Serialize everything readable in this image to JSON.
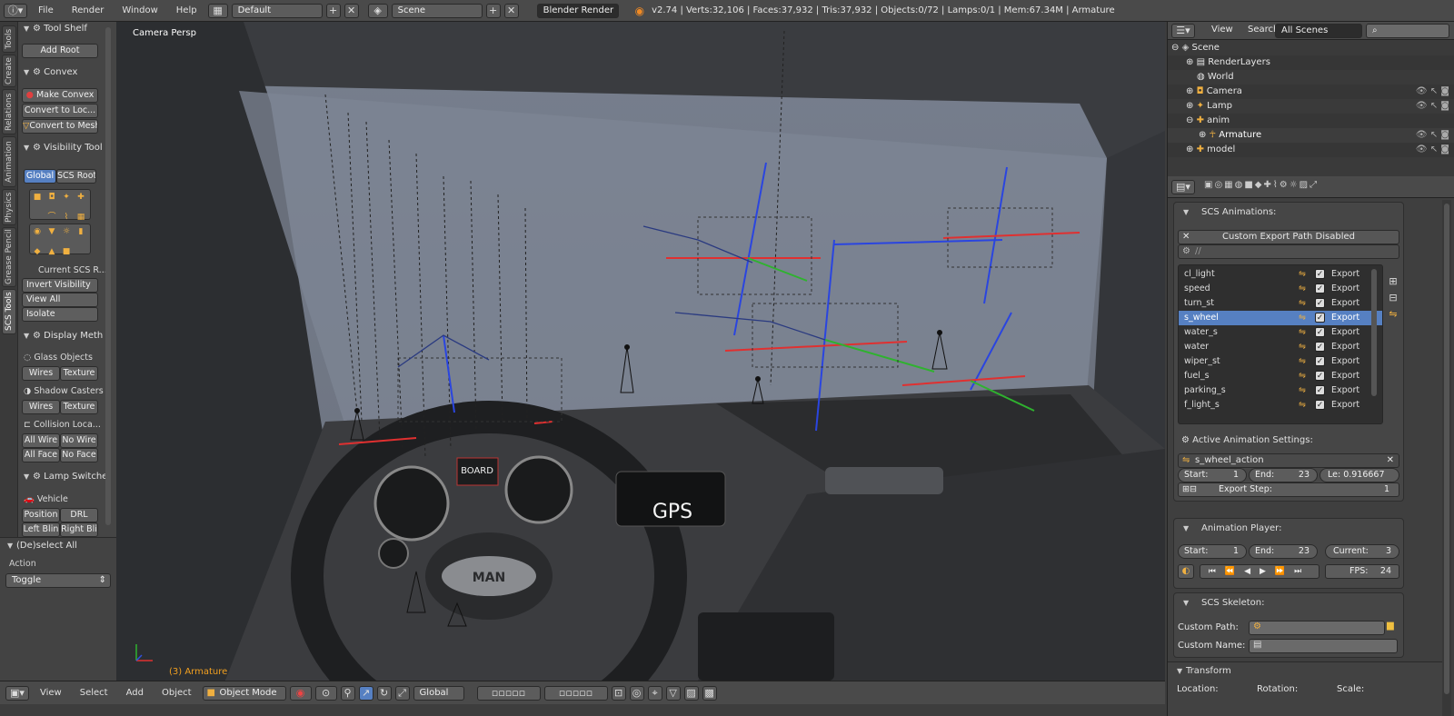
{
  "topbar": {
    "menus": [
      "File",
      "Render",
      "Window",
      "Help"
    ],
    "screen_layout": "Default",
    "scene": "Scene",
    "render_engine": "Blender Render",
    "stats": "v2.74 | Verts:32,106 | Faces:37,932 | Tris:37,932 | Objects:0/72 | Lamps:0/1 | Mem:67.34M | Armature"
  },
  "left_tabs": [
    "Tools",
    "Create",
    "Relations",
    "Animation",
    "Physics",
    "Grease Pencil",
    "SCS Tools"
  ],
  "shelf": {
    "tool_shelf": {
      "title": "Tool Shelf",
      "add_root": "Add Root"
    },
    "convex": {
      "title": "Convex",
      "make_convex": "Make Convex",
      "convert_loc": "Convert to Loc...",
      "convert_mesh": "Convert to Mesh"
    },
    "visibility": {
      "title": "Visibility Tool",
      "global": "Global",
      "scs_root": "SCS Root",
      "current": "Current SCS R...",
      "invert": "Invert Visibility",
      "view_all": "View All",
      "isolate": "Isolate"
    },
    "display": {
      "title": "Display Meth",
      "glass": "Glass Objects",
      "shadow": "Shadow Casters",
      "collision": "Collision Loca...",
      "wires": "Wires",
      "texture": "Texture",
      "all_wire": "All Wire",
      "no_wire": "No Wire",
      "all_face": "All Face",
      "no_face": "No Face"
    },
    "lamp": {
      "title": "Lamp Switche",
      "vehicle": "Vehicle",
      "position": "Position",
      "drl": "DRL",
      "left_blink": "Left Blin",
      "right_blink": "Right Bli"
    },
    "operator": {
      "title": "(De)select All",
      "action_label": "Action",
      "action_value": "Toggle"
    }
  },
  "viewport": {
    "view_label": "Camera Persp",
    "object_label": "(3) Armature",
    "board_text": "BOARD",
    "gps_text": "GPS",
    "brand_text": "MAN"
  },
  "bottombar": {
    "menus": [
      "View",
      "Select",
      "Add",
      "Object"
    ],
    "mode": "Object Mode",
    "orientation": "Global"
  },
  "outliner": {
    "view": "View",
    "search": "Search",
    "filter": "All Scenes",
    "items": [
      {
        "name": "Scene",
        "indent": 0
      },
      {
        "name": "RenderLayers",
        "indent": 1
      },
      {
        "name": "World",
        "indent": 1
      },
      {
        "name": "Camera",
        "indent": 1
      },
      {
        "name": "Lamp",
        "indent": 1
      },
      {
        "name": "anim",
        "indent": 1
      },
      {
        "name": "Armature",
        "indent": 2
      },
      {
        "name": "model",
        "indent": 1
      }
    ]
  },
  "props": {
    "scs_animations": "SCS Animations:",
    "custom_export": "Custom Export Path Disabled",
    "path_placeholder": "//",
    "animations": [
      {
        "name": "cl_light",
        "export": "Export"
      },
      {
        "name": "speed",
        "export": "Export"
      },
      {
        "name": "turn_st",
        "export": "Export"
      },
      {
        "name": "s_wheel",
        "export": "Export",
        "selected": true
      },
      {
        "name": "water_s",
        "export": "Export"
      },
      {
        "name": "water",
        "export": "Export"
      },
      {
        "name": "wiper_st",
        "export": "Export"
      },
      {
        "name": "fuel_s",
        "export": "Export"
      },
      {
        "name": "parking_s",
        "export": "Export"
      },
      {
        "name": "f_light_s",
        "export": "Export"
      }
    ],
    "active_settings": "Active Animation Settings:",
    "action_name": "s_wheel_action",
    "start_label": "Start:",
    "start_value": "1",
    "end_label": "End:",
    "end_value": "23",
    "length_label": "Le: 0.916667",
    "export_step_label": "Export Step:",
    "export_step_value": "1",
    "anim_player": "Animation Player:",
    "player_start": "1",
    "player_end": "23",
    "current_label": "Current:",
    "current_value": "3",
    "fps_label": "FPS:",
    "fps_value": "24",
    "scs_skeleton": "SCS Skeleton:",
    "custom_path": "Custom Path:",
    "custom_name": "Custom Name:",
    "transform": "Transform",
    "location": "Location:",
    "rotation": "Rotation:",
    "scale": "Scale:"
  },
  "colors": {
    "selection": "#5680c2",
    "panel": "#464646",
    "header": "#4a4a4a",
    "axis_red": "#e03030",
    "axis_green": "#30c030",
    "axis_blue": "#3050e0"
  }
}
